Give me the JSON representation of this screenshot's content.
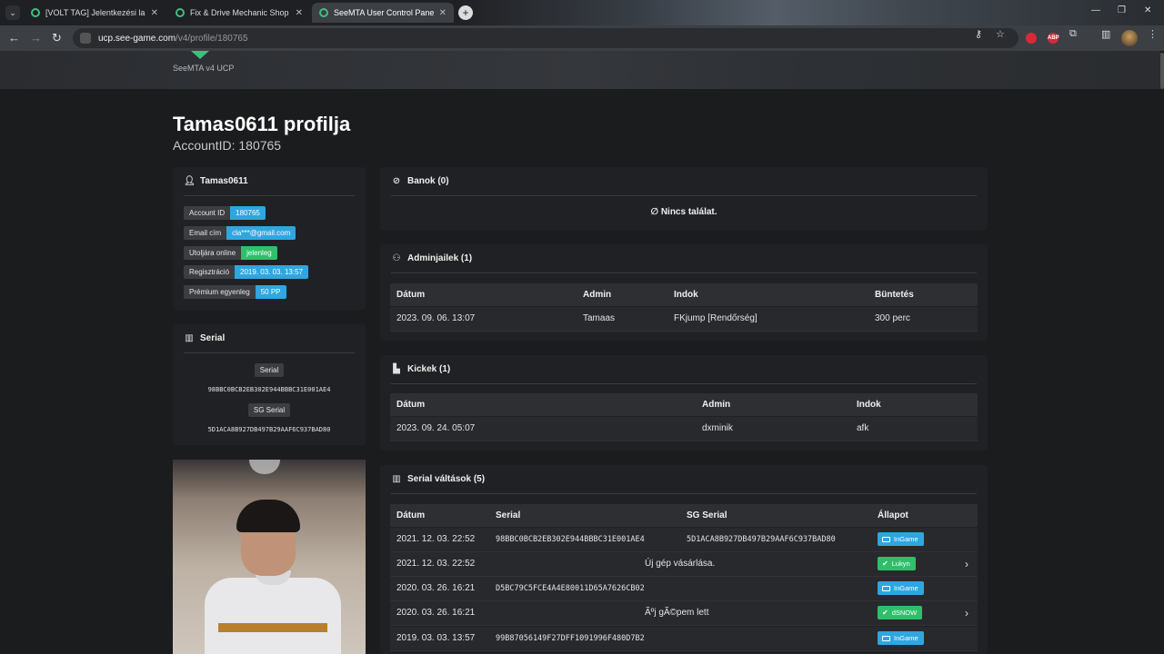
{
  "browser": {
    "tabs": [
      {
        "label": "[VOLT TAG] Jelentkezési lap [M",
        "active": false
      },
      {
        "label": "Fix & Drive Mechanic Shop - Je",
        "active": false
      },
      {
        "label": "SeeMTA User Control Panel",
        "active": true
      }
    ],
    "url_host": "ucp.see-game.com",
    "url_path": "/v4/profile/180765",
    "extension_labels": [
      "ABP"
    ]
  },
  "site": {
    "subtitle": "SeeMTA v4 UCP"
  },
  "profile": {
    "title": "Tamas0611 profilja",
    "account_line": "AccountID: 180765",
    "card_name": "Tamas0611",
    "info": [
      {
        "key": "Account ID",
        "value": "180765",
        "color": "blue"
      },
      {
        "key": "Email cím",
        "value": "cla***@gmail.com",
        "color": "blue"
      },
      {
        "key": "Utoljára online",
        "value": "jelenleg",
        "color": "green"
      },
      {
        "key": "Regisztráció",
        "value": "2019. 03. 03. 13:57",
        "color": "blue"
      },
      {
        "key": "Prémium egyenleg",
        "value": "50 PP",
        "color": "blue"
      }
    ]
  },
  "serial_card": {
    "title": "Serial",
    "serial_label": "Serial",
    "serial_value": "98BBC0BCB2EB302E944BBBC31E001AE4",
    "sg_label": "SG Serial",
    "sg_value": "5D1ACA8B927DB497B29AAF6C937BAD80"
  },
  "bans": {
    "title": "Banok (0)",
    "empty_text": "Nincs találat."
  },
  "adminjails": {
    "title": "Adminjailek (1)",
    "headers": [
      "Dátum",
      "Admin",
      "Indok",
      "Büntetés"
    ],
    "rows": [
      [
        "2023. 09. 06. 13:07",
        "Tamaas",
        "FKjump [Rendőrség]",
        "300 perc"
      ]
    ]
  },
  "kicks": {
    "title": "Kickek (1)",
    "headers": [
      "Dátum",
      "Admin",
      "Indok"
    ],
    "rows": [
      [
        "2023. 09. 24. 05:07",
        "dxminik",
        "afk"
      ]
    ]
  },
  "serial_changes": {
    "title": "Serial váltások (5)",
    "headers": [
      "Dátum",
      "Serial",
      "SG Serial",
      "Állapot"
    ],
    "rows": [
      {
        "date": "2021. 12. 03. 22:52",
        "serial": "98BBC0BCB2EB302E944BBBC31E001AE4",
        "sg": "5D1ACA8B927DB497B29AAF6C937BAD80",
        "note": "",
        "status": "InGame",
        "status_color": "blue",
        "expandable": false
      },
      {
        "date": "2021. 12. 03. 22:52",
        "serial": "",
        "sg": "",
        "note": "Új gép vásárlása.",
        "status": "Lukyn",
        "status_color": "green",
        "expandable": true
      },
      {
        "date": "2020. 03. 26. 16:21",
        "serial": "D5BC79C5FCE4A4E80011D65A7626CB02",
        "sg": "",
        "note": "",
        "status": "InGame",
        "status_color": "blue",
        "expandable": false
      },
      {
        "date": "2020. 03. 26. 16:21",
        "serial": "",
        "sg": "",
        "note": "Ãºj gÃ©pem lett",
        "status": "dSNOW",
        "status_color": "green",
        "expandable": true
      },
      {
        "date": "2019. 03. 03. 13:57",
        "serial": "99B87056149F27DFF1091996F480D7B2",
        "sg": "",
        "note": "",
        "status": "InGame",
        "status_color": "blue",
        "expandable": false
      }
    ]
  }
}
